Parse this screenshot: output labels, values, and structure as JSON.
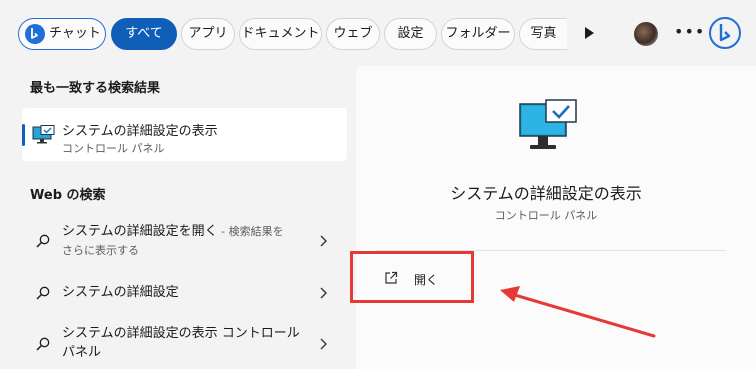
{
  "topbar": {
    "chips": [
      {
        "label": "チャット"
      },
      {
        "label": "すべて"
      },
      {
        "label": "アプリ"
      },
      {
        "label": "ドキュメント"
      },
      {
        "label": "ウェブ"
      },
      {
        "label": "設定"
      },
      {
        "label": "フォルダー"
      },
      {
        "label": "写真"
      }
    ],
    "active_chip": "すべて",
    "accent_color": "#0f5fb8"
  },
  "left": {
    "best_match_heading": "最も一致する検索結果",
    "best_match": {
      "title": "システムの詳細設定の表示",
      "subtitle": "コントロール パネル",
      "icon": "monitor-check-icon"
    },
    "web_heading": "Web の検索",
    "web_results": [
      {
        "main": "システムの詳細設定を開く",
        "minor": " - 検索結果を",
        "line2": "さらに表示する"
      },
      {
        "main": "システムの詳細設定",
        "minor": "",
        "line2": ""
      },
      {
        "main": "システムの詳細設定の表示 コントロール",
        "minor": "",
        "line2": "パネル"
      }
    ]
  },
  "detail": {
    "title": "システムの詳細設定の表示",
    "subtitle": "コントロール パネル",
    "action_label": "開く",
    "icon": "monitor-check-icon"
  },
  "annotation": {
    "box_color": "#e53935"
  }
}
